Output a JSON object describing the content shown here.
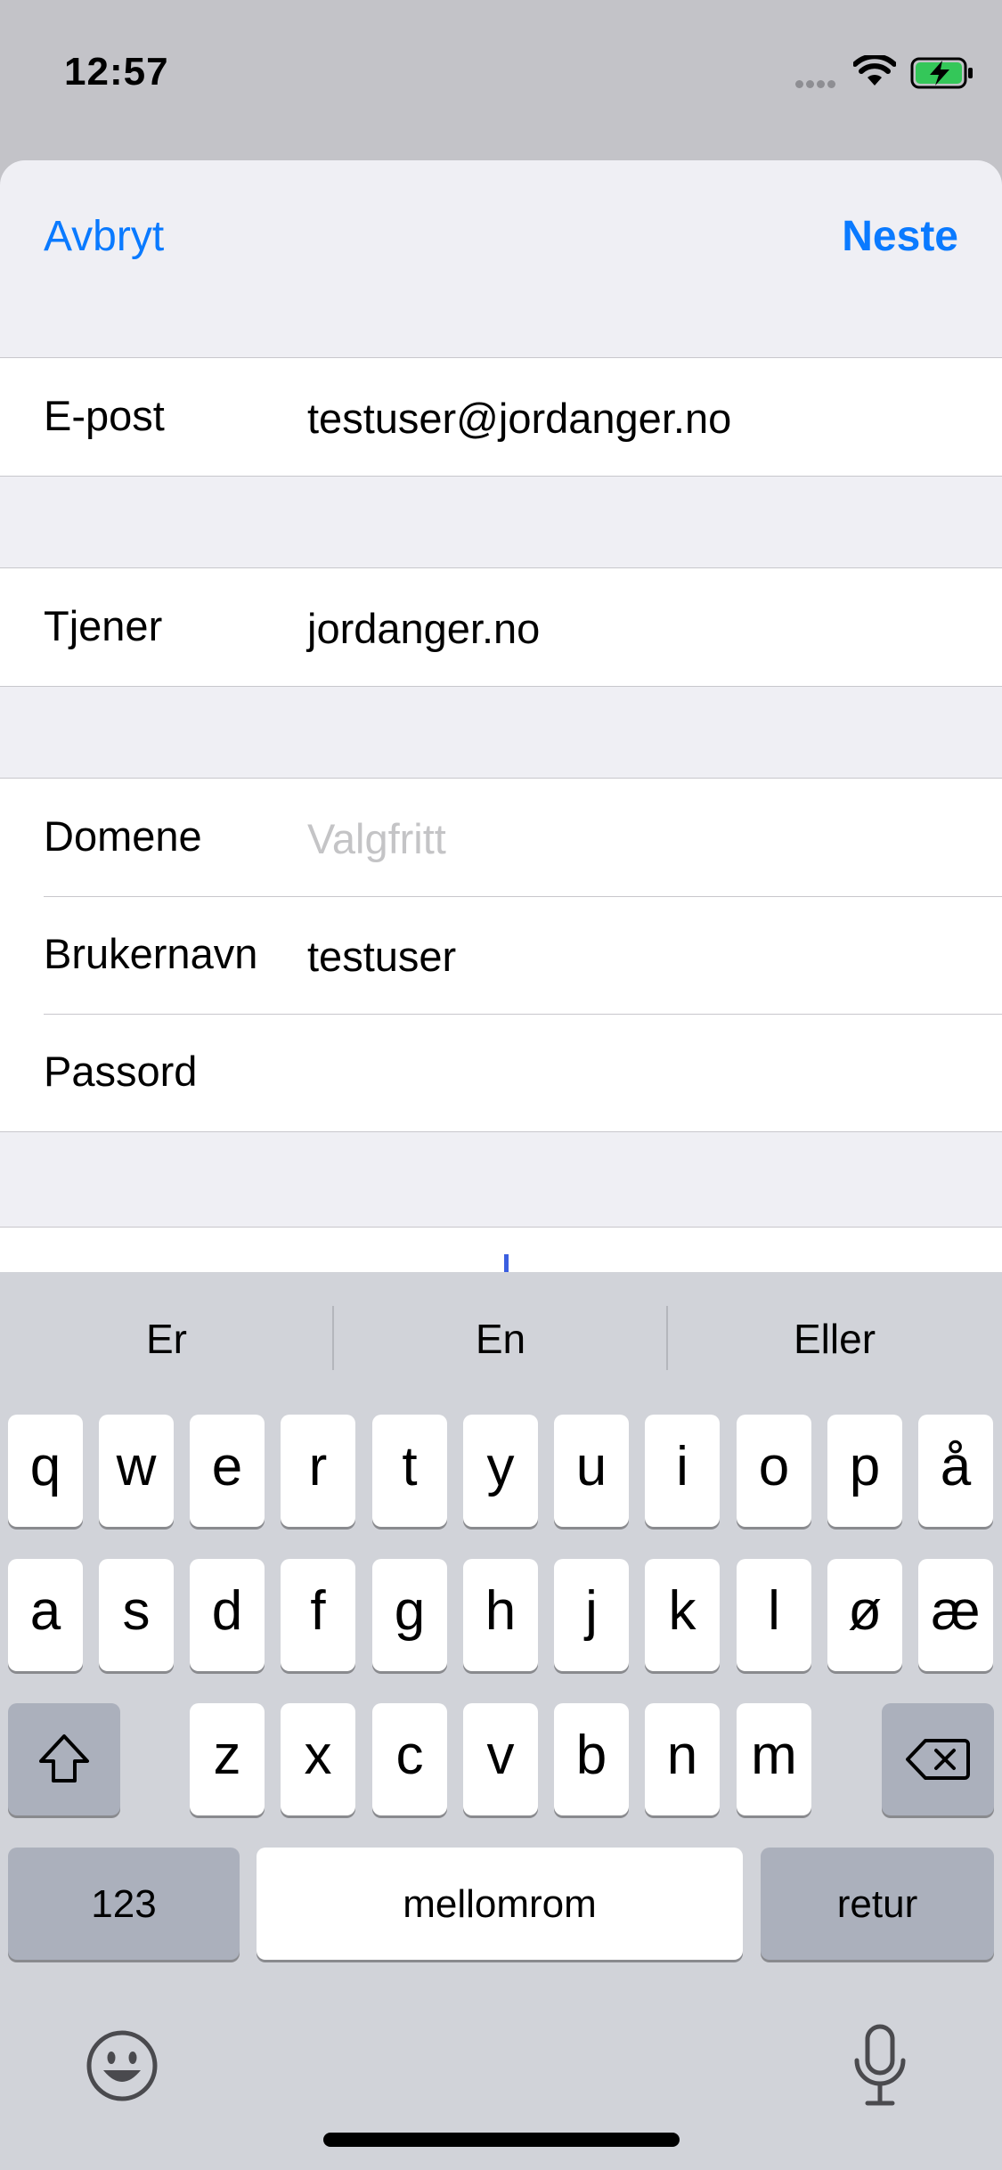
{
  "status_bar": {
    "time": "12:57"
  },
  "nav": {
    "cancel_label": "Avbryt",
    "next_label": "Neste"
  },
  "form": {
    "email": {
      "label": "E-post",
      "value": "testuser@jordanger.no"
    },
    "server": {
      "label": "Tjener",
      "value": "jordanger.no"
    },
    "domain": {
      "label": "Domene",
      "placeholder": "Valgfritt"
    },
    "username": {
      "label": "Brukernavn",
      "value": "testuser"
    },
    "password": {
      "label": "Passord",
      "value": ""
    }
  },
  "keyboard": {
    "suggestions": [
      "Er",
      "En",
      "Eller"
    ],
    "row1": [
      "q",
      "w",
      "e",
      "r",
      "t",
      "y",
      "u",
      "i",
      "o",
      "p",
      "å"
    ],
    "row2": [
      "a",
      "s",
      "d",
      "f",
      "g",
      "h",
      "j",
      "k",
      "l",
      "ø",
      "æ"
    ],
    "row3": [
      "z",
      "x",
      "c",
      "v",
      "b",
      "n",
      "m"
    ],
    "numbers_label": "123",
    "space_label": "mellomrom",
    "return_label": "retur"
  },
  "icons": [
    "signal-icon",
    "wifi-icon",
    "battery-charging-icon",
    "shift-icon",
    "backspace-icon",
    "emoji-icon",
    "microphone-icon"
  ],
  "colors": {
    "accent": "#0a7aff",
    "battery_green": "#34c759"
  }
}
